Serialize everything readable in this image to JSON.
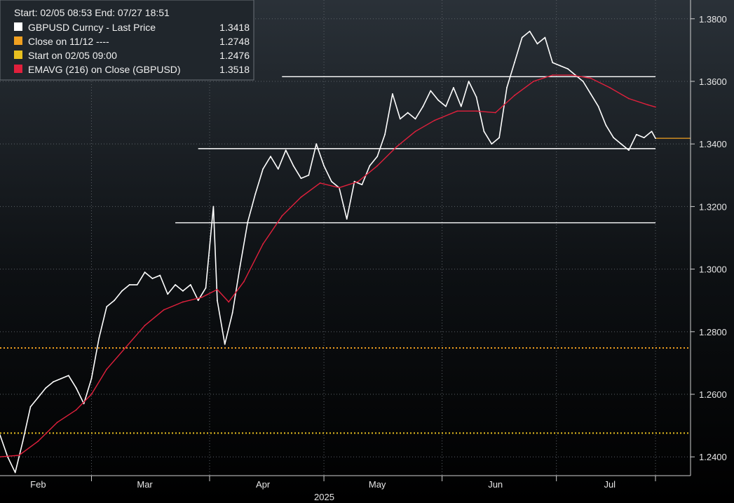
{
  "chart_data": {
    "type": "line",
    "title": "",
    "xlabel": "2025",
    "ylabel": "",
    "ylim": [
      1.234,
      1.386
    ],
    "y_ticks": [
      "1.2400",
      "1.2600",
      "1.2800",
      "1.3000",
      "1.3200",
      "1.3400",
      "1.3600",
      "1.3800"
    ],
    "y_tick_values": [
      1.24,
      1.26,
      1.28,
      1.3,
      1.32,
      1.34,
      1.36,
      1.38
    ],
    "x_tick_labels": [
      "Feb",
      "Mar",
      "Apr",
      "May",
      "Jun",
      "Jul"
    ],
    "x_tick_dates": [
      "2025-02-15",
      "2025-03-15",
      "2025-04-15",
      "2025-05-15",
      "2025-06-15",
      "2025-07-15"
    ],
    "x_range": [
      "2025-02-05",
      "2025-07-27"
    ],
    "grid": true,
    "legend": {
      "placement": "top-left",
      "header": "Start: 02/05 08:53 End: 07/27 18:51",
      "entries": [
        {
          "label": "GBPUSD Curncy - Last Price",
          "value": "1.3418",
          "color": "#ffffff"
        },
        {
          "label": "Close on 11/12 ----",
          "value": "1.2748",
          "color": "#f0a020"
        },
        {
          "label": "Start on 02/05 09:00",
          "value": "1.2476",
          "color": "#e8c020"
        },
        {
          "label": "EMAVG (216)  on Close (GBPUSD)",
          "value": "1.3518",
          "color": "#e0203c"
        }
      ]
    },
    "series": [
      {
        "name": "GBPUSD Curncy - Last Price",
        "color": "#ffffff",
        "x": [
          "2025-02-05",
          "2025-02-07",
          "2025-02-09",
          "2025-02-11",
          "2025-02-13",
          "2025-02-15",
          "2025-02-17",
          "2025-02-19",
          "2025-02-21",
          "2025-02-23",
          "2025-02-25",
          "2025-02-27",
          "2025-03-01",
          "2025-03-03",
          "2025-03-05",
          "2025-03-07",
          "2025-03-09",
          "2025-03-11",
          "2025-03-13",
          "2025-03-15",
          "2025-03-17",
          "2025-03-19",
          "2025-03-21",
          "2025-03-23",
          "2025-03-25",
          "2025-03-27",
          "2025-03-29",
          "2025-03-31",
          "2025-04-02",
          "2025-04-03",
          "2025-04-05",
          "2025-04-07",
          "2025-04-09",
          "2025-04-11",
          "2025-04-13",
          "2025-04-15",
          "2025-04-17",
          "2025-04-19",
          "2025-04-21",
          "2025-04-23",
          "2025-04-25",
          "2025-04-27",
          "2025-04-29",
          "2025-05-01",
          "2025-05-03",
          "2025-05-05",
          "2025-05-07",
          "2025-05-09",
          "2025-05-11",
          "2025-05-13",
          "2025-05-15",
          "2025-05-17",
          "2025-05-19",
          "2025-05-21",
          "2025-05-23",
          "2025-05-25",
          "2025-05-27",
          "2025-05-29",
          "2025-05-31",
          "2025-06-02",
          "2025-06-04",
          "2025-06-06",
          "2025-06-08",
          "2025-06-10",
          "2025-06-12",
          "2025-06-14",
          "2025-06-16",
          "2025-06-18",
          "2025-06-20",
          "2025-06-22",
          "2025-06-24",
          "2025-06-26",
          "2025-06-28",
          "2025-06-30",
          "2025-07-02",
          "2025-07-04",
          "2025-07-06",
          "2025-07-08",
          "2025-07-10",
          "2025-07-12",
          "2025-07-14",
          "2025-07-16",
          "2025-07-18",
          "2025-07-20",
          "2025-07-22",
          "2025-07-24",
          "2025-07-26",
          "2025-07-27"
        ],
        "values": [
          1.247,
          1.24,
          1.235,
          1.245,
          1.256,
          1.259,
          1.262,
          1.264,
          1.265,
          1.266,
          1.262,
          1.257,
          1.265,
          1.278,
          1.288,
          1.29,
          1.293,
          1.295,
          1.295,
          1.299,
          1.297,
          1.298,
          1.292,
          1.295,
          1.293,
          1.295,
          1.29,
          1.294,
          1.32,
          1.29,
          1.276,
          1.286,
          1.301,
          1.315,
          1.324,
          1.332,
          1.336,
          1.332,
          1.338,
          1.333,
          1.329,
          1.33,
          1.34,
          1.333,
          1.328,
          1.326,
          1.316,
          1.328,
          1.327,
          1.333,
          1.336,
          1.343,
          1.356,
          1.348,
          1.35,
          1.348,
          1.352,
          1.357,
          1.354,
          1.352,
          1.358,
          1.352,
          1.36,
          1.355,
          1.344,
          1.34,
          1.342,
          1.358,
          1.366,
          1.374,
          1.376,
          1.372,
          1.374,
          1.366,
          1.365,
          1.364,
          1.362,
          1.36,
          1.356,
          1.352,
          1.346,
          1.342,
          1.34,
          1.338,
          1.343,
          1.342,
          1.344,
          1.3418
        ]
      },
      {
        "name": "EMAVG (216)  on Close (GBPUSD)",
        "color": "#e0203c",
        "x": [
          "2025-02-05",
          "2025-02-10",
          "2025-02-15",
          "2025-02-20",
          "2025-02-25",
          "2025-03-01",
          "2025-03-05",
          "2025-03-10",
          "2025-03-15",
          "2025-03-20",
          "2025-03-25",
          "2025-03-30",
          "2025-04-03",
          "2025-04-06",
          "2025-04-10",
          "2025-04-15",
          "2025-04-20",
          "2025-04-25",
          "2025-04-30",
          "2025-05-05",
          "2025-05-10",
          "2025-05-15",
          "2025-05-20",
          "2025-05-25",
          "2025-05-30",
          "2025-06-05",
          "2025-06-10",
          "2025-06-15",
          "2025-06-20",
          "2025-06-25",
          "2025-06-30",
          "2025-07-05",
          "2025-07-10",
          "2025-07-15",
          "2025-07-20",
          "2025-07-25",
          "2025-07-27"
        ],
        "values": [
          1.24,
          1.2405,
          1.245,
          1.251,
          1.255,
          1.26,
          1.268,
          1.275,
          1.282,
          1.287,
          1.2895,
          1.291,
          1.2935,
          1.2895,
          1.296,
          1.308,
          1.317,
          1.323,
          1.3275,
          1.326,
          1.328,
          1.333,
          1.339,
          1.344,
          1.3475,
          1.3505,
          1.3505,
          1.35,
          1.3555,
          1.36,
          1.362,
          1.362,
          1.361,
          1.358,
          1.3545,
          1.3525,
          1.3518
        ]
      }
    ],
    "reference_lines": [
      {
        "label": "Close on 11/12 ----",
        "value": 1.2748,
        "color": "#f0a020",
        "style": "dotted"
      },
      {
        "label": "Start on 02/05 09:00",
        "value": 1.2476,
        "color": "#e8c020",
        "style": "dotted"
      },
      {
        "label": "last-price-marker",
        "value": 1.3418,
        "color": "#f0a020",
        "style": "solid",
        "from": "2025-07-27"
      }
    ],
    "annotation_lines": [
      {
        "value": 1.3615,
        "color": "#ffffff",
        "from": "2025-04-20",
        "to": "2025-07-27"
      },
      {
        "value": 1.3385,
        "color": "#ffffff",
        "from": "2025-03-29",
        "to": "2025-07-27"
      },
      {
        "value": 1.3148,
        "color": "#ffffff",
        "from": "2025-03-23",
        "to": "2025-07-27"
      }
    ]
  }
}
